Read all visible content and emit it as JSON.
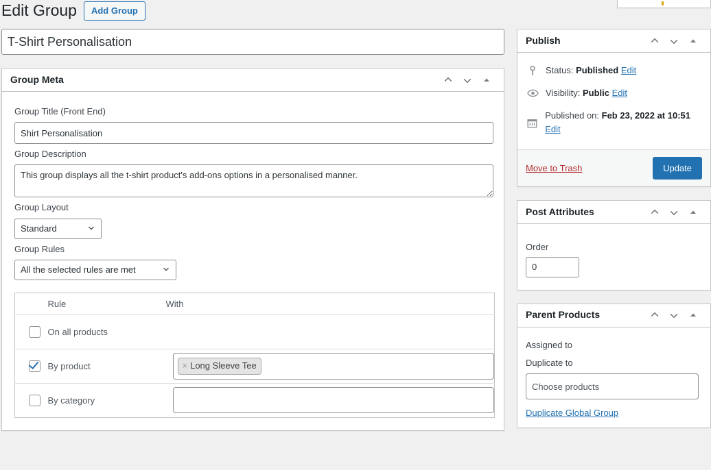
{
  "page": {
    "title": "Edit Group",
    "add_button_label": "Add Group",
    "post_title_value": "T-Shirt Personalisation"
  },
  "group_meta": {
    "panel_title": "Group Meta",
    "fields": {
      "title_label": "Group Title (Front End)",
      "title_value": "Shirt Personalisation",
      "description_label": "Group Description",
      "description_value": "This group displays all the t-shirt product's add-ons options in a personalised manner.",
      "layout_label": "Group Layout",
      "layout_value": "Standard",
      "layout_options": [
        "Standard"
      ],
      "rules_label": "Group Rules",
      "rules_value": "All the selected rules are met",
      "rules_options": [
        "All the selected rules are met"
      ]
    },
    "rules_table": {
      "headers": [
        "",
        "Rule",
        "With"
      ],
      "rows": [
        {
          "checked": false,
          "rule": "On all products",
          "with_type": "none",
          "tokens": []
        },
        {
          "checked": true,
          "rule": "By product",
          "with_type": "tokens",
          "tokens": [
            "Long Sleeve Tee"
          ],
          "remove_glyph": "×"
        },
        {
          "checked": false,
          "rule": "By category",
          "with_type": "tokens",
          "tokens": []
        }
      ]
    }
  },
  "publish": {
    "panel_title": "Publish",
    "status_prefix": "Status:",
    "status_value": "Published",
    "status_edit": "Edit",
    "visibility_prefix": "Visibility:",
    "visibility_value": "Public",
    "visibility_edit": "Edit",
    "published_prefix": "Published on:",
    "published_value": "Feb 23, 2022 at 10:51",
    "published_edit": "Edit",
    "trash_label": "Move to Trash",
    "update_label": "Update",
    "icons": [
      "pin-icon",
      "eye-icon",
      "calendar-icon"
    ],
    "accent_color": "#2271b1",
    "trash_color": "#b32d2e"
  },
  "post_attributes": {
    "panel_title": "Post Attributes",
    "order_label": "Order",
    "order_value": "0"
  },
  "parent_products": {
    "panel_title": "Parent Products",
    "assigned_to_label": "Assigned to",
    "duplicate_to_label": "Duplicate to",
    "choose_placeholder": "Choose products",
    "choose_value": "",
    "duplicate_link_label": "Duplicate Global Group"
  },
  "panel_controls": {
    "move_up": "move-up",
    "move_down": "move-down",
    "toggle": "toggle-panel"
  }
}
